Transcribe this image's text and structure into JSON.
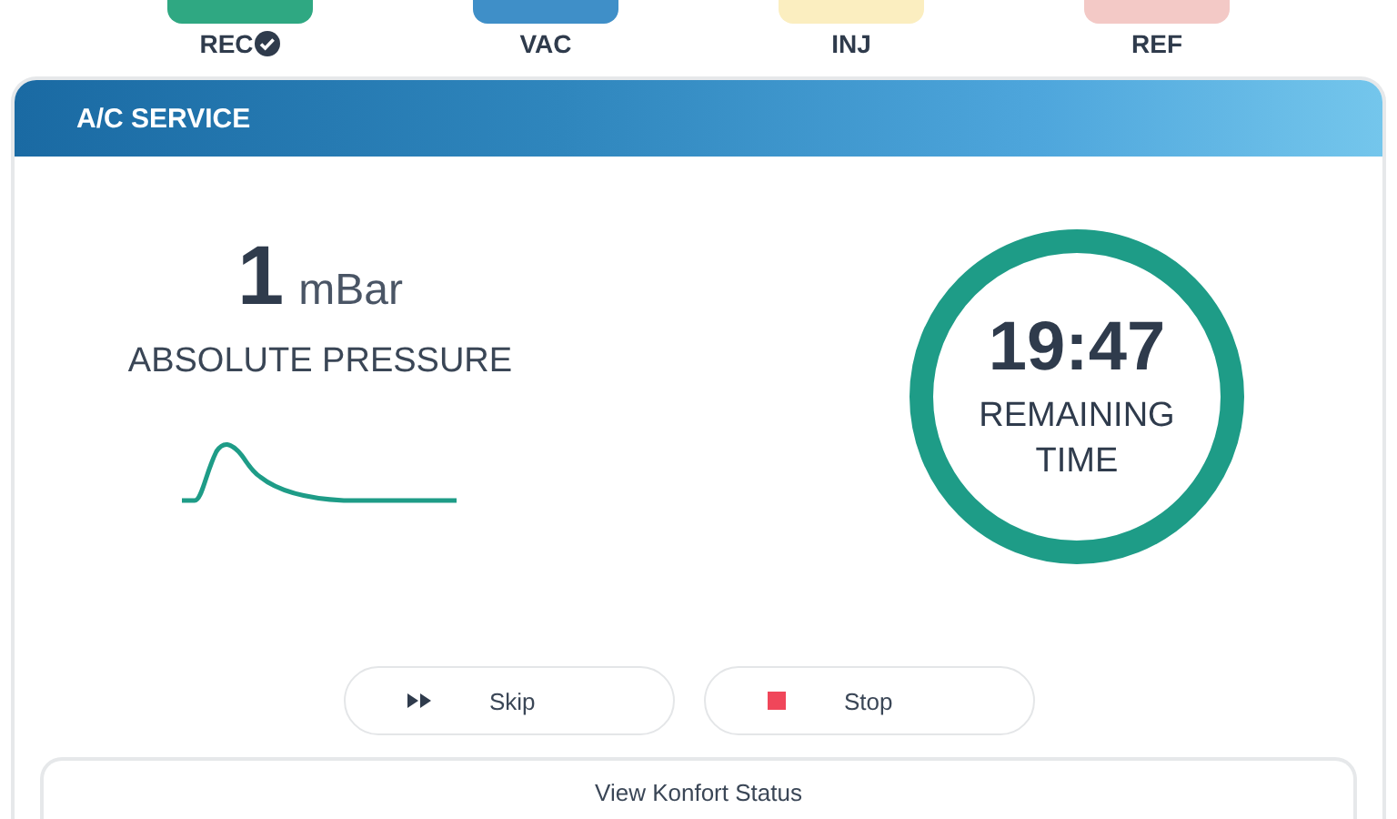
{
  "steps": [
    {
      "label": "REC",
      "color": "#2fa882",
      "done": true
    },
    {
      "label": "VAC",
      "color": "#3f8fc8",
      "done": false
    },
    {
      "label": "INJ",
      "color": "#fbeec0",
      "done": false
    },
    {
      "label": "REF",
      "color": "#f3c9c6",
      "done": false
    }
  ],
  "panel": {
    "title": "A/C SERVICE",
    "pressure": {
      "value": "1",
      "unit": "mBar",
      "label": "ABSOLUTE PRESSURE"
    },
    "timer": {
      "time": "19:47",
      "label": "REMAINING TIME"
    },
    "buttons": [
      {
        "kind": "skip",
        "label": "Skip"
      },
      {
        "kind": "stop",
        "label": "Stop"
      }
    ],
    "footer": "View Konfort Status"
  }
}
